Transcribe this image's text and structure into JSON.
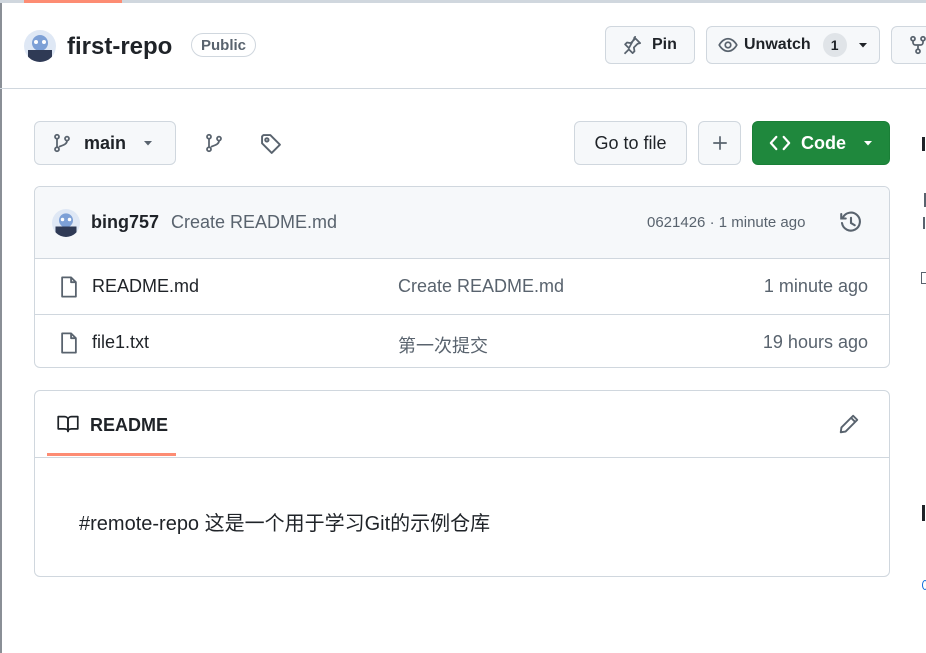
{
  "repo": {
    "name": "first-repo",
    "visibility": "Public",
    "actions": {
      "pin": "Pin",
      "unwatch": "Unwatch",
      "watch_count": "1"
    }
  },
  "toolbar": {
    "branch": "main",
    "go_to_file": "Go to file",
    "add": "+",
    "code": "Code"
  },
  "latest_commit": {
    "author": "bing757",
    "message": "Create README.md",
    "meta": "0621426 · 1 minute ago"
  },
  "files": [
    {
      "name": "README.md",
      "commit": "Create README.md",
      "time": "1 minute ago"
    },
    {
      "name": "file1.txt",
      "commit": "第一次提交",
      "time": "19 hours ago"
    }
  ],
  "readme": {
    "title": "README",
    "content": "#remote-repo 这是一个用于学习Git的示例仓库"
  },
  "colors": {
    "accent": "#fd8c73",
    "code_button": "#1f883d",
    "border": "#d0d7de",
    "muted": "#59636e"
  },
  "icons": [
    "avatar-icon",
    "pin-icon",
    "eye-icon",
    "fork-icon",
    "branch-icon",
    "branches-icon",
    "tag-icon",
    "code-icon",
    "chevron-down-icon",
    "history-icon",
    "file-icon",
    "book-icon",
    "pencil-icon"
  ]
}
